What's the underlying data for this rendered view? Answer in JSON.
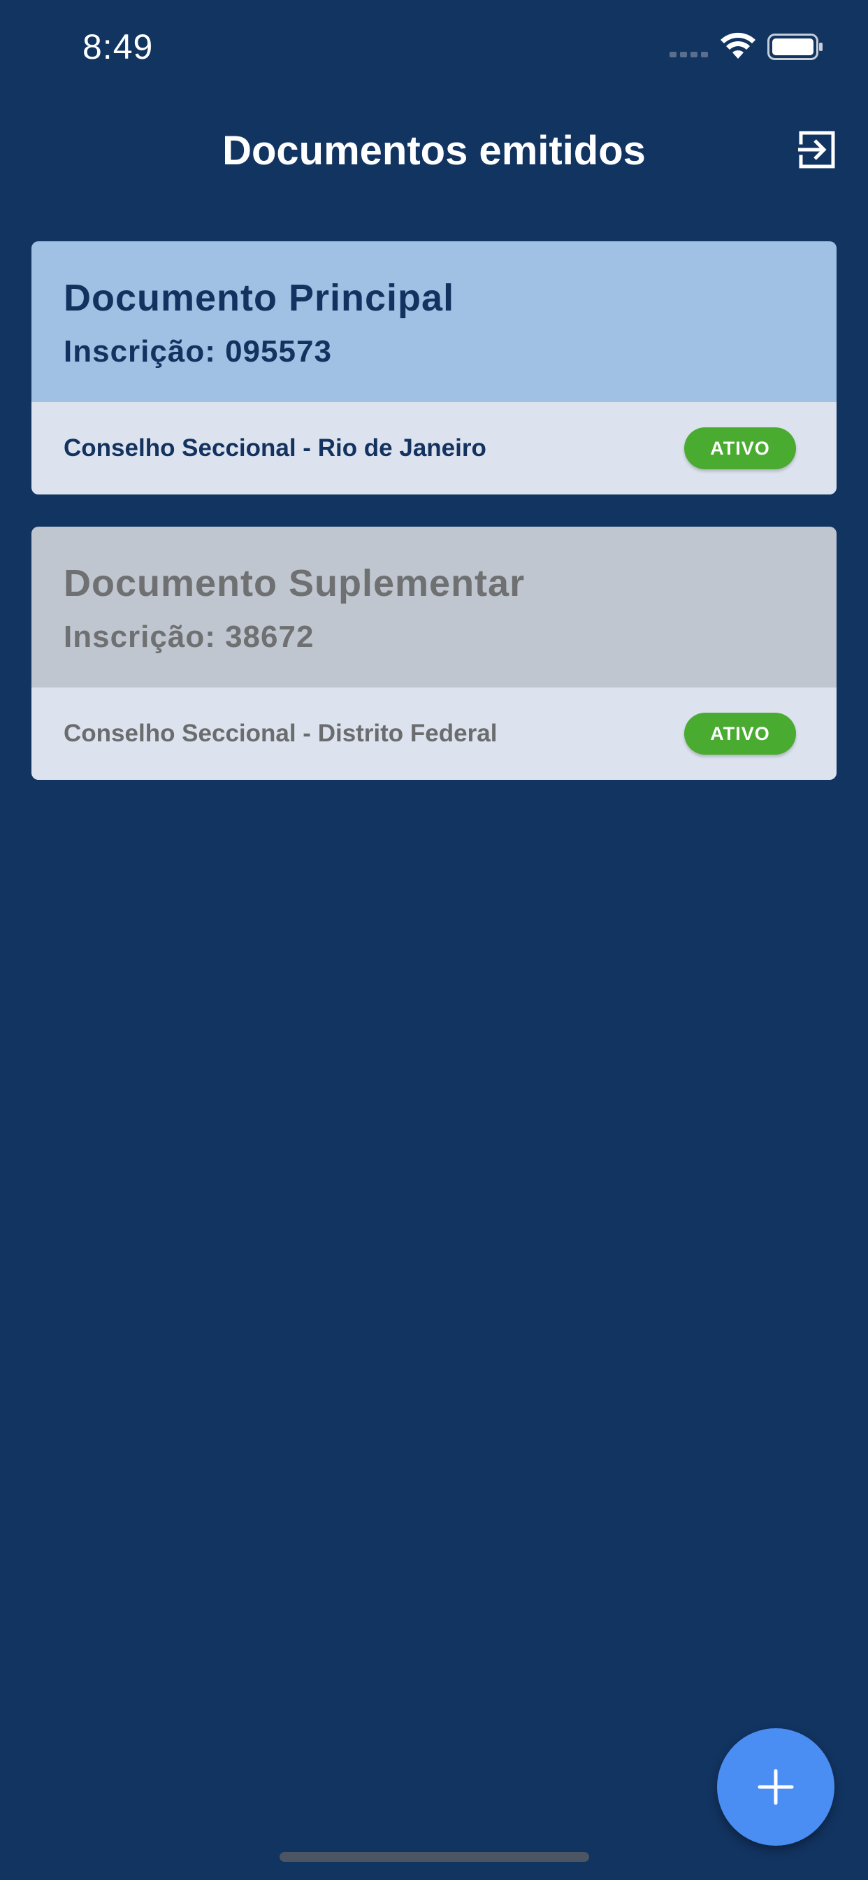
{
  "status_bar": {
    "time": "8:49"
  },
  "header": {
    "title": "Documentos emitidos",
    "logout_icon": "logout-icon"
  },
  "documents": [
    {
      "title": "Documento Principal",
      "registration": "Inscrição: 095573",
      "council": "Conselho Seccional - Rio de Janeiro",
      "status": "ATIVO"
    },
    {
      "title": "Documento Suplementar",
      "registration": "Inscrição: 38672",
      "council": "Conselho Seccional - Distrito Federal",
      "status": "ATIVO"
    }
  ],
  "fab": {
    "icon": "plus-icon"
  },
  "colors": {
    "background": "#123461",
    "primary_card_header": "#a0c0e4",
    "secondary_card_header": "#c0c6cf",
    "card_footer": "#dce3ee",
    "status_active": "#4aab31",
    "fab": "#4a8ef4"
  }
}
